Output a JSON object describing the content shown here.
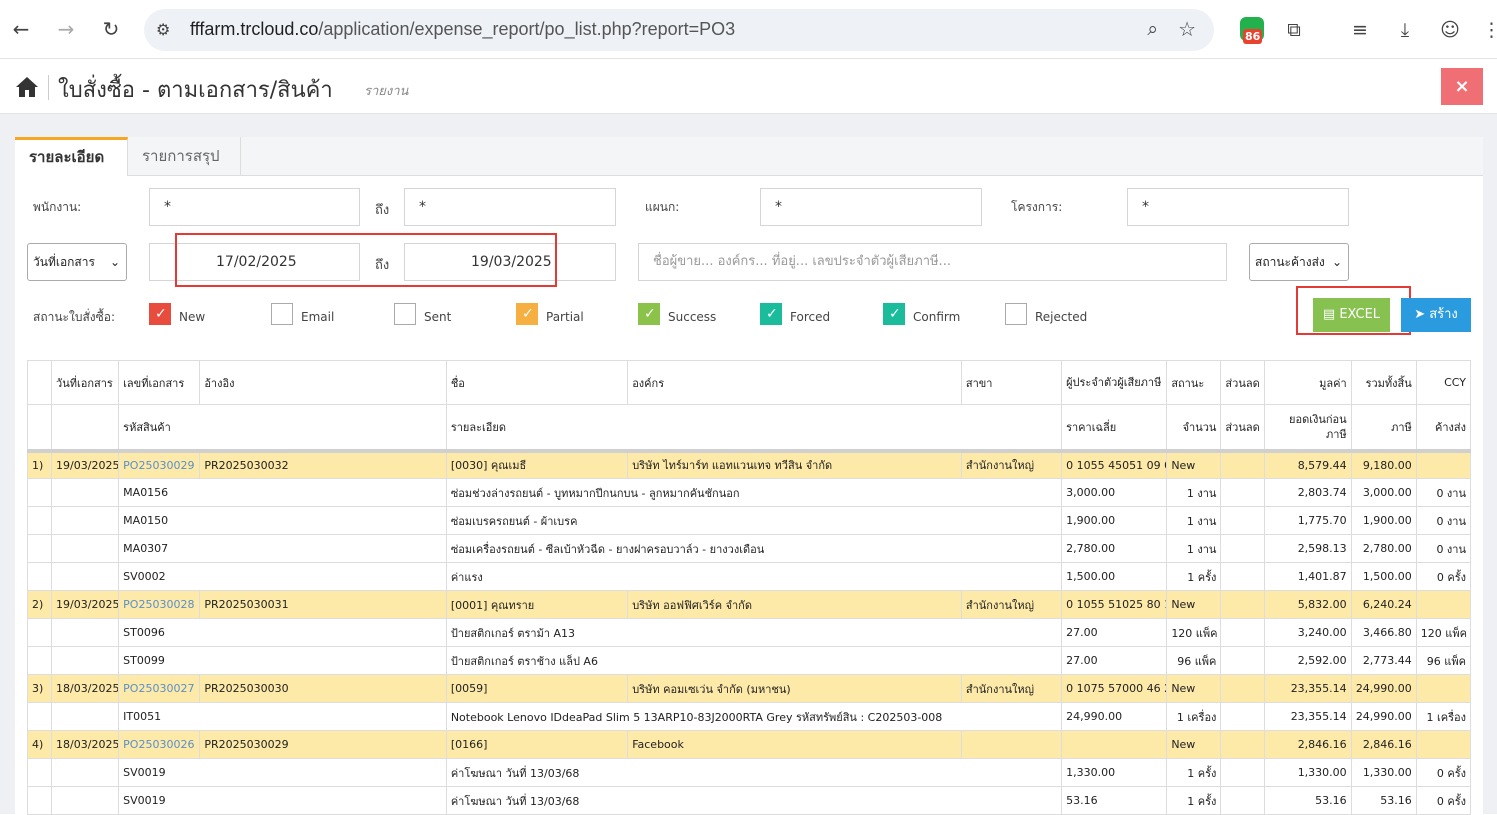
{
  "browser": {
    "url_domain": "fffarm.trcloud.co",
    "url_path": "/application/expense_report/po_list.php?report=PO3",
    "ext_badge_count": "86"
  },
  "header": {
    "title": "ใบสั่งซื้อ - ตามเอกสาร/สินค้า",
    "subtitle": "รายงาน",
    "close_label": "×"
  },
  "tabs": [
    {
      "label": "รายละเอียด"
    },
    {
      "label": "รายการสรุป"
    }
  ],
  "filters": {
    "employee_label": "พนักงาน:",
    "employee_from": "*",
    "to_label": "ถึง",
    "employee_to": "*",
    "department_label": "แผนก:",
    "department_value": "*",
    "project_label": "โครงการ:",
    "project_value": "*",
    "date_type_select": "วันที่เอกสาร",
    "date_from": "17/02/2025",
    "date_to": "19/03/2025",
    "search_placeholder": "ชื่อผู้ขาย... องค์กร... ที่อยู่... เลขประจำตัวผู้เสียภาษี...",
    "outstanding_select": "สถานะค้างส่ง",
    "status_label": "สถานะใบสั่งซื้อ:"
  },
  "statuses": [
    {
      "label": "New",
      "checked": true,
      "color": "#e74c3c"
    },
    {
      "label": "Email",
      "checked": false,
      "color": ""
    },
    {
      "label": "Sent",
      "checked": false,
      "color": ""
    },
    {
      "label": "Partial",
      "checked": true,
      "color": "#f5b041"
    },
    {
      "label": "Success",
      "checked": true,
      "color": "#8bc34a"
    },
    {
      "label": "Forced",
      "checked": true,
      "color": "#1abc9c"
    },
    {
      "label": "Confirm",
      "checked": true,
      "color": "#1abc9c"
    },
    {
      "label": "Rejected",
      "checked": false,
      "color": ""
    }
  ],
  "actions": {
    "excel_label": "EXCEL",
    "create_label": "สร้าง"
  },
  "table": {
    "header1": [
      "",
      "วันที่เอกสาร",
      "เลขที่เอกสาร",
      "อ้างอิง",
      "ชื่อ",
      "องค์กร",
      "สาขา",
      "ผู้ประจำตัวผู้เสียภาษี",
      "สถานะ",
      "ส่วนลด",
      "มูลค่า",
      "รวมทั้งสิ้น",
      "CCY"
    ],
    "header2": {
      "code": "รหัสสินค้า",
      "detail": "รายละเอียด",
      "avg_price": "ราคาเฉลี่ย",
      "qty": "จำนวน",
      "discount": "ส่วนลด",
      "pre_tax": "ยอดเงินก่อนภาษี",
      "tax": "ภาษี",
      "outstanding": "ค้างส่ง"
    },
    "rows": [
      {
        "type": "po",
        "no": "1)",
        "date": "19/03/2025",
        "doc": "PO25030029",
        "ref": "PR2025030032",
        "name": "[0030] คุณเมธี",
        "org": "บริษัท ไทร์มาร์ท แอทแวนเทจ ทวีสิน จำกัด",
        "branch": "สำนักงานใหญ่",
        "taxid": "0 1055 45051 09 0",
        "status": "New",
        "discount": "",
        "value": "8,579.44",
        "total": "9,180.00",
        "ccy": ""
      },
      {
        "type": "item",
        "code": "MA0156",
        "detail": "ซ่อมช่วงล่างรถยนต์ - บูทหมากปีกนกบน - ลูกหมากคันชักนอก",
        "price": "3,000.00",
        "qty": "1 งาน",
        "discount": "",
        "pretax": "2,803.74",
        "tax": "3,000.00",
        "outstanding": "0 งาน"
      },
      {
        "type": "item",
        "code": "MA0150",
        "detail": "ซ่อมเบรครถยนต์ - ผ้าเบรค",
        "price": "1,900.00",
        "qty": "1 งาน",
        "discount": "",
        "pretax": "1,775.70",
        "tax": "1,900.00",
        "outstanding": "0 งาน"
      },
      {
        "type": "item",
        "code": "MA0307",
        "detail": "ซ่อมเครื่องรถยนต์ - ซีลเบ้าหัวฉีด - ยางฝาครอบวาล์ว - ยางวงเดือน",
        "price": "2,780.00",
        "qty": "1 งาน",
        "discount": "",
        "pretax": "2,598.13",
        "tax": "2,780.00",
        "outstanding": "0 งาน"
      },
      {
        "type": "item",
        "code": "SV0002",
        "detail": "ค่าแรง",
        "price": "1,500.00",
        "qty": "1 ครั้ง",
        "discount": "",
        "pretax": "1,401.87",
        "tax": "1,500.00",
        "outstanding": "0 ครั้ง"
      },
      {
        "type": "po",
        "no": "2)",
        "date": "19/03/2025",
        "doc": "PO25030028",
        "ref": "PR2025030031",
        "name": "[0001] คุณทราย",
        "org": "บริษัท ออฟฟิศเวิร์ค จำกัด",
        "branch": "สำนักงานใหญ่",
        "taxid": "0 1055 51025 80 1",
        "status": "New",
        "discount": "",
        "value": "5,832.00",
        "total": "6,240.24",
        "ccy": ""
      },
      {
        "type": "item",
        "code": "ST0096",
        "detail": "ป้ายสติกเกอร์ ตราม้า A13",
        "price": "27.00",
        "qty": "120 แพ็ค",
        "discount": "",
        "pretax": "3,240.00",
        "tax": "3,466.80",
        "outstanding": "120 แพ็ค"
      },
      {
        "type": "item",
        "code": "ST0099",
        "detail": "ป้ายสติกเกอร์ ตราช้าง แล็ป A6",
        "price": "27.00",
        "qty": "96 แพ็ค",
        "discount": "",
        "pretax": "2,592.00",
        "tax": "2,773.44",
        "outstanding": "96 แพ็ค"
      },
      {
        "type": "po",
        "no": "3)",
        "date": "18/03/2025",
        "doc": "PO25030027",
        "ref": "PR2025030030",
        "name": "[0059]",
        "org": "บริษัท คอมเซเว่น จำกัด (มหาชน)",
        "branch": "สำนักงานใหญ่",
        "taxid": "0 1075 57000 46 2",
        "status": "New",
        "discount": "",
        "value": "23,355.14",
        "total": "24,990.00",
        "ccy": ""
      },
      {
        "type": "item",
        "code": "IT0051",
        "detail": "Notebook Lenovo IDdeaPad Slim 5 13ARP10-83J2000RTA Grey รหัสทรัพย์สิน : C202503-008",
        "price": "24,990.00",
        "qty": "1 เครื่อง",
        "discount": "",
        "pretax": "23,355.14",
        "tax": "24,990.00",
        "outstanding": "1 เครื่อง"
      },
      {
        "type": "po",
        "no": "4)",
        "date": "18/03/2025",
        "doc": "PO25030026",
        "ref": "PR2025030029",
        "name": "[0166]",
        "org": "Facebook",
        "branch": "",
        "taxid": "",
        "status": "New",
        "discount": "",
        "value": "2,846.16",
        "total": "2,846.16",
        "ccy": ""
      },
      {
        "type": "item",
        "code": "SV0019",
        "detail": "ค่าโฆษณา วันที่ 13/03/68",
        "price": "1,330.00",
        "qty": "1 ครั้ง",
        "discount": "",
        "pretax": "1,330.00",
        "tax": "1,330.00",
        "outstanding": "0 ครั้ง"
      },
      {
        "type": "item",
        "code": "SV0019",
        "detail": "ค่าโฆษณา วันที่ 13/03/68",
        "price": "53.16",
        "qty": "1 ครั้ง",
        "discount": "",
        "pretax": "53.16",
        "tax": "53.16",
        "outstanding": "0 ครั้ง"
      }
    ]
  }
}
